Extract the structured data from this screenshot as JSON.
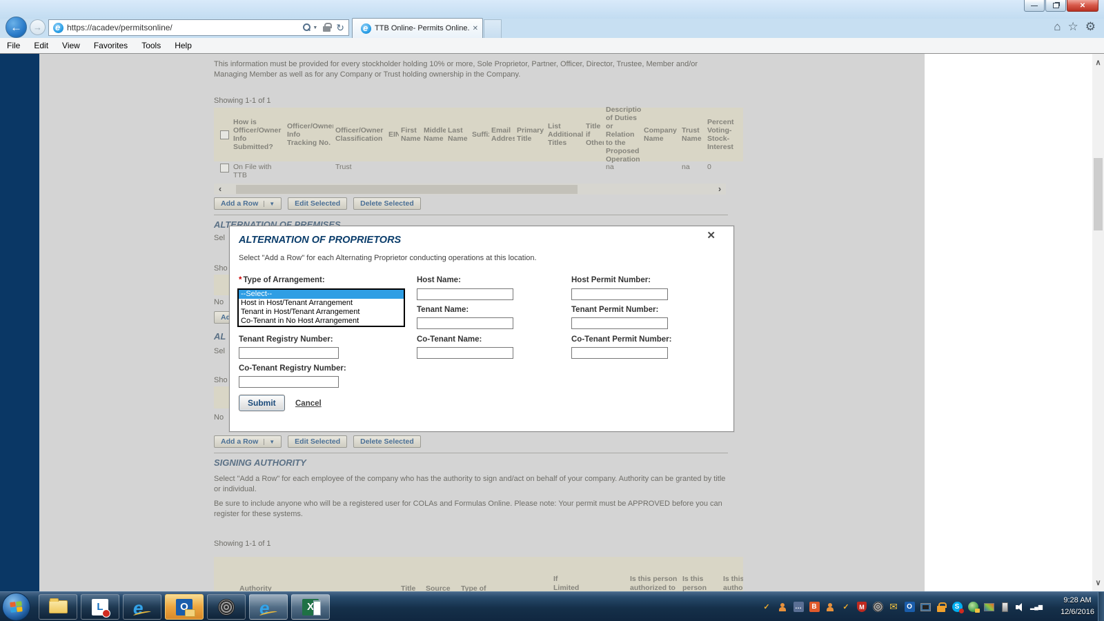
{
  "browser": {
    "url": "https://acadev/permitsonline/",
    "tab_title": "TTB Online- Permits Online...",
    "menu": [
      "File",
      "Edit",
      "View",
      "Favorites",
      "Tools",
      "Help"
    ]
  },
  "page": {
    "intro": "This information must be provided for every stockholder holding 10% or more, Sole Proprietor, Partner, Officer, Director, Trustee, Member and/or Managing Member as well as for any Company or Trust holding ownership in the Company.",
    "showing1": "Showing 1-1 of 1",
    "officer_table": {
      "headers": [
        "",
        "How is Officer/Owner Info Submitted?",
        "Officer/Owner Info Tracking No.",
        "Officer/Owner Classification",
        "EIN",
        "First Name",
        "Middle Name",
        "Last Name",
        "Suffix",
        "Email Address",
        "Primary Title",
        "List Additional Titles",
        "Title if Other",
        "Description of Duties or Relation to the Proposed Operation",
        "Company Name",
        "Trust Name",
        "Percent Voting-Stock-Interest"
      ],
      "row": {
        "submitted": "On File with TTB",
        "classification": "Trust",
        "description": "na",
        "trust_name": "na",
        "percent": "0"
      }
    },
    "toolbar": {
      "add_row": "Add a Row",
      "edit": "Edit Selected",
      "delete": "Delete Selected",
      "caret": "▼"
    },
    "premises_heading": "ALTERNATION OF PREMISES",
    "fragments": {
      "select1": "Sel",
      "showing1": "Sho",
      "no1": "No",
      "add_btn": "Ad",
      "heading2": "AL",
      "select2": "Sel",
      "showing2": "Sho",
      "no2": "No"
    },
    "signing": {
      "heading": "SIGNING AUTHORITY",
      "p1": "Select \"Add a Row\" for each employee of the company who has the authority to sign and/act on behalf of your company. Authority can be granted by title or individual.",
      "p2": "Be sure to include anyone who will be a registered user for COLAs and Formulas Online. Please note: Your permit must be APPROVED before you can register for these systems.",
      "showing": "Showing 1-1 of 1",
      "partial_headers": [
        "Authority",
        "Title",
        "Source",
        "Type of",
        "If\nLimited",
        "Is this person\nauthorized to",
        "Is this\nperson",
        "Is this pe\nauthorize"
      ]
    }
  },
  "modal": {
    "title": "ALTERNATION OF PROPRIETORS",
    "subtitle": "Select \"Add a Row\" for each Alternating Proprietor conducting operations at this location.",
    "required_marker": "*",
    "fields": {
      "type_label": "Type of Arrangement:",
      "host_name": "Host Name:",
      "host_permit": "Host Permit Number:",
      "tenant_name": "Tenant Name:",
      "tenant_permit": "Tenant Permit Number:",
      "tenant_registry": "Tenant Registry Number:",
      "co_tenant_name": "Co-Tenant Name:",
      "co_tenant_permit": "Co-Tenant Permit Number:",
      "co_tenant_registry": "Co-Tenant Registry Number:"
    },
    "dropdown": {
      "options": [
        "--Select--",
        "Host in Host/Tenant Arrangement",
        "Tenant in Host/Tenant Arrangement",
        "Co-Tenant in No Host Arrangement"
      ],
      "selected": "--Select--"
    },
    "submit": "Submit",
    "cancel": "Cancel",
    "close": "✕"
  },
  "taskbar": {
    "time": "9:28 AM",
    "date": "12/6/2016"
  },
  "colors": {
    "selection_blue": "#2f9ee4",
    "heading_navy": "#0b3d6b",
    "navy_strip": "#0a3765",
    "table_header_beige": "#d9d6c6"
  }
}
